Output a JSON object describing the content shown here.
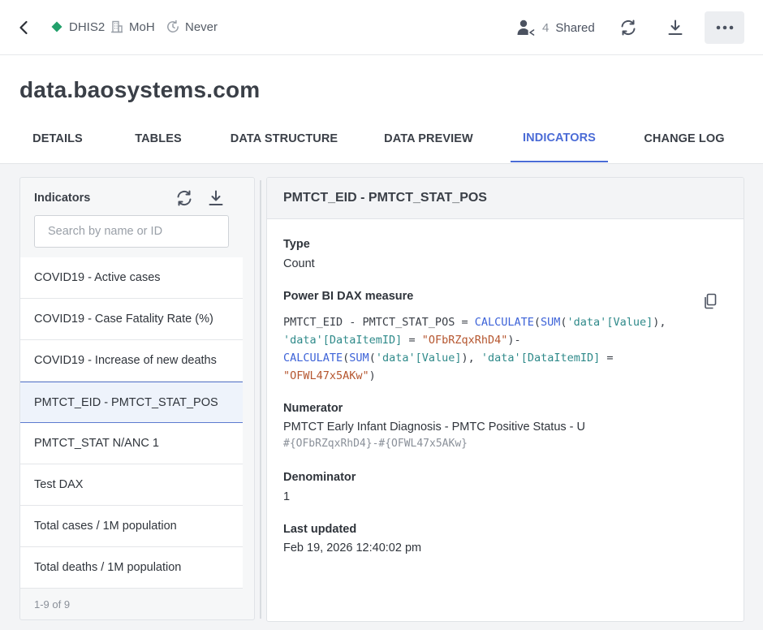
{
  "topbar": {
    "instance": "DHIS2",
    "org": "MoH",
    "schedule": "Never",
    "shared_count": "4",
    "shared_label": "Shared",
    "colors": {
      "instance_dot": "#22a06b",
      "accent": "#4a6bd6"
    }
  },
  "page": {
    "title": "data.baosystems.com"
  },
  "tabs": [
    {
      "label": "DETAILS"
    },
    {
      "label": "TABLES"
    },
    {
      "label": "DATA STRUCTURE"
    },
    {
      "label": "DATA PREVIEW"
    },
    {
      "label": "INDICATORS",
      "active": true
    },
    {
      "label": "CHANGE LOG"
    }
  ],
  "indicators_panel": {
    "title": "Indicators",
    "search_placeholder": "Search by name or ID",
    "items": [
      {
        "label": "COVID19 - Active cases"
      },
      {
        "label": "COVID19 - Case Fatality Rate (%)"
      },
      {
        "label": "COVID19 - Increase of new deaths"
      },
      {
        "label": "PMTCT_EID - PMTCT_STAT_POS",
        "selected": true
      },
      {
        "label": "PMTCT_STAT N/ANC 1"
      },
      {
        "label": "Test DAX"
      },
      {
        "label": "Total cases / 1M population"
      },
      {
        "label": "Total deaths / 1M population"
      }
    ],
    "footer": "1-9 of 9"
  },
  "detail": {
    "title": "PMTCT_EID - PMTCT_STAT_POS",
    "type_label": "Type",
    "type_value": "Count",
    "dax_label": "Power BI DAX measure",
    "dax": {
      "prefix": "PMTCT_EID - PMTCT_STAT_POS = ",
      "calculate": "CALCULATE",
      "sum": "SUM",
      "tbl_data": "'data'",
      "col_value": "[Value]",
      "col_item": "[DataItemID]",
      "id1": "\"OFbRZqxRhD4\"",
      "id2": "\"OFWL47x5AKw\""
    },
    "numerator_label": "Numerator",
    "numerator_value": "PMTCT Early Infant Diagnosis - PMTC Positive Status - U",
    "numerator_formula": "#{OFbRZqxRhD4}-#{OFWL47x5AKw}",
    "denominator_label": "Denominator",
    "denominator_value": "1",
    "updated_label": "Last updated",
    "updated_value": "Feb 19, 2026 12:40:02 pm"
  }
}
